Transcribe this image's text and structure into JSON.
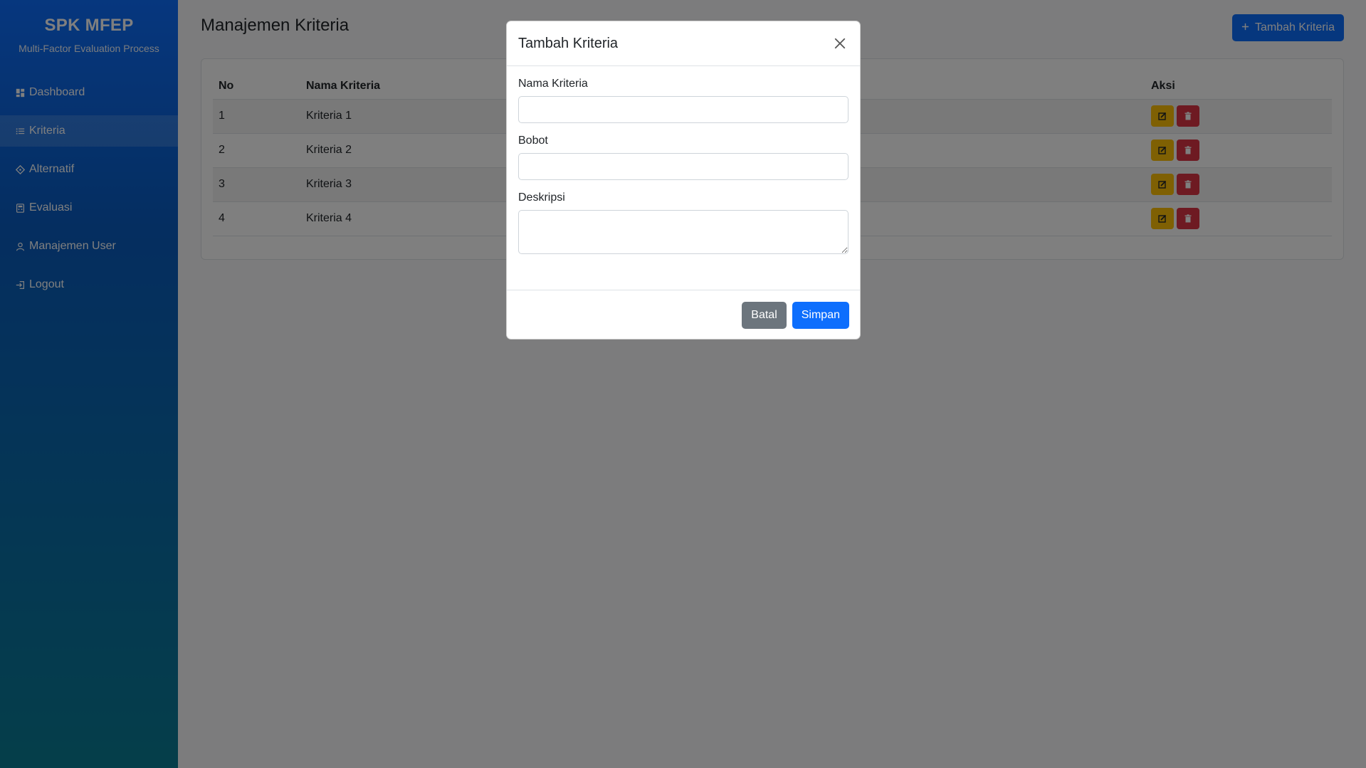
{
  "sidebar": {
    "brand_title": "SPK MFEP",
    "brand_subtitle": "Multi-Factor Evaluation Process",
    "items": [
      {
        "label": "Dashboard",
        "icon": "dashboard-icon"
      },
      {
        "label": "Kriteria",
        "icon": "list-icon",
        "active": true
      },
      {
        "label": "Alternatif",
        "icon": "diamond-icon"
      },
      {
        "label": "Evaluasi",
        "icon": "calculator-icon"
      },
      {
        "label": "Manajemen User",
        "icon": "user-icon"
      },
      {
        "label": "Logout",
        "icon": "logout-icon"
      }
    ]
  },
  "header": {
    "title": "Manajemen Kriteria",
    "add_button_label": "Tambah Kriteria",
    "add_button_icon": "plus-icon"
  },
  "table": {
    "columns": [
      "No",
      "Nama Kriteria",
      "Aksi"
    ],
    "rows": [
      {
        "no": "1",
        "name": "Kriteria 1"
      },
      {
        "no": "2",
        "name": "Kriteria 2"
      },
      {
        "no": "3",
        "name": "Kriteria 3"
      },
      {
        "no": "4",
        "name": "Kriteria 4"
      }
    ]
  },
  "modal": {
    "title": "Tambah Kriteria",
    "fields": {
      "nama_label": "Nama Kriteria",
      "nama_value": "",
      "bobot_label": "Bobot",
      "bobot_value": "",
      "deskripsi_label": "Deskripsi",
      "deskripsi_value": ""
    },
    "cancel_label": "Batal",
    "save_label": "Simpan"
  },
  "colors": {
    "primary": "#0d6efd",
    "warning": "#ffc107",
    "danger": "#dc3545",
    "secondary": "#6c757d",
    "sidebar_top": "#0d6efd",
    "sidebar_bottom": "#0a7d94"
  }
}
